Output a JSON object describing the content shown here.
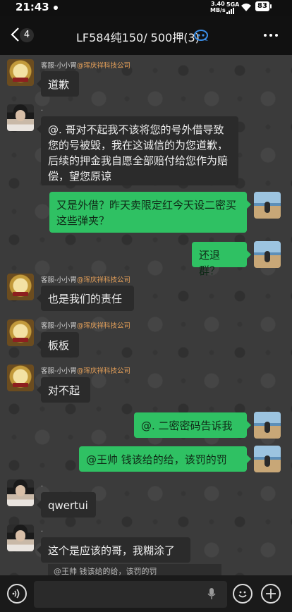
{
  "status_bar": {
    "time": "21:43",
    "net_speed": "3.40",
    "net_unit": "MB/s",
    "network": "5GA",
    "battery": "83"
  },
  "header": {
    "back_count": "4",
    "title": "LF584纯150/ 500押(3)"
  },
  "messages": [
    {
      "sender": "客服-小小胃",
      "org": "@珲庆祥科技公司",
      "text": "道歉"
    },
    {
      "sender": ".",
      "text": "@. 哥对不起我不该将您的号外借导致您的号被毁，我在这诚信的为您道歉，后续的押金我自愿全部赔付给您作为赔偿，望您原谅"
    },
    {
      "text": "又是外借？昨天卖限定红今天设二密买这些弹夹？"
    },
    {
      "text": "还退群？"
    },
    {
      "sender": "客服-小小胃",
      "org": "@珲庆祥科技公司",
      "text": "也是我们的责任"
    },
    {
      "sender": "客服-小小胃",
      "org": "@珲庆祥科技公司",
      "text": "板板"
    },
    {
      "sender": "客服-小小胃",
      "org": "@珲庆祥科技公司",
      "text": "对不起"
    },
    {
      "text": "@. 二密密码告诉我"
    },
    {
      "text": "@王帅  钱该给的给，该罚的罚"
    },
    {
      "sender": ".",
      "text": "qwertui"
    },
    {
      "sender": ".",
      "text": "这个是应该的哥，我糊涂了",
      "quote": "@王帅 钱该给的给，该罚的罚"
    }
  ],
  "colors": {
    "accent_green": "#2fc163",
    "org_orange": "#e8a25a",
    "bubble_dark": "#2b2b2b"
  },
  "icons": [
    "back-chevron-icon",
    "robot-icon",
    "more-icon",
    "voice-icon",
    "mic-icon",
    "emoji-icon",
    "plus-icon"
  ]
}
